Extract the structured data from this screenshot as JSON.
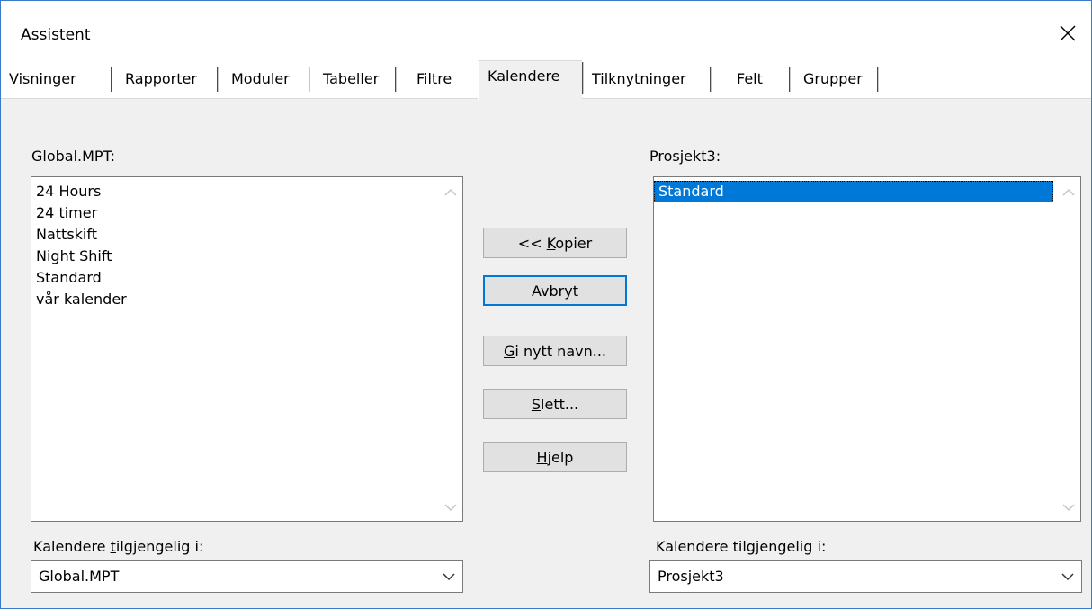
{
  "window": {
    "title": "Assistent",
    "close_icon": "close-icon"
  },
  "tabs": [
    {
      "label": "Visninger",
      "active": false
    },
    {
      "label": "Rapporter",
      "active": false
    },
    {
      "label": "Moduler",
      "active": false
    },
    {
      "label": "Tabeller",
      "active": false
    },
    {
      "label": "Filtre",
      "active": false
    },
    {
      "label": "Kalendere",
      "active": true
    },
    {
      "label": "Tilknytninger",
      "active": false
    },
    {
      "label": "Felt",
      "active": false
    },
    {
      "label": "Grupper",
      "active": false
    }
  ],
  "left": {
    "header": "Global.MPT:",
    "items": [
      "24 Hours",
      "24 timer",
      "Nattskift",
      "Night Shift",
      "Standard",
      "vår kalender"
    ],
    "available_label_pre": "Kalendere ",
    "available_label_ul": "t",
    "available_label_post": "ilgjengelig i:",
    "combo_value": "Global.MPT"
  },
  "right": {
    "header": "Prosjekt3:",
    "items": [
      "Standard"
    ],
    "selected_index": 0,
    "available_label_pre": "Kalendere tilg",
    "available_label_ul": "j",
    "available_label_post": "engelig i:",
    "combo_value": "Prosjekt3"
  },
  "buttons": {
    "copy_pre": "<< ",
    "copy_ul": "K",
    "copy_post": "opier",
    "cancel": "Avbryt",
    "rename_ul": "G",
    "rename_post": "i nytt navn...",
    "delete_ul": "S",
    "delete_post": "lett...",
    "help_ul": "H",
    "help_post": "jelp"
  },
  "colors": {
    "selection": "#0078d7",
    "window_border": "#3c78c8",
    "button_face": "#e1e1e1"
  }
}
